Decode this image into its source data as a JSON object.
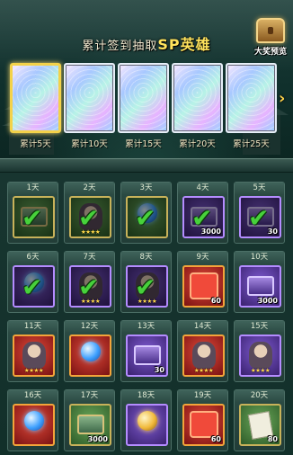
{
  "header": {
    "title_prefix": "累计签到抽取",
    "title_sp": "SP",
    "title_suffix": "英雄",
    "preview_label": "大奖预览"
  },
  "milestones": [
    {
      "label": "累计5天",
      "selected": true
    },
    {
      "label": "累计10天",
      "selected": false
    },
    {
      "label": "累计15天",
      "selected": false
    },
    {
      "label": "累计20天",
      "selected": false
    },
    {
      "label": "累计25天",
      "selected": false
    }
  ],
  "days": [
    {
      "day": "1天",
      "kind": "green",
      "icon": "chest-icon",
      "claimed": true,
      "qty": "",
      "stars": ""
    },
    {
      "day": "2天",
      "kind": "green",
      "icon": "hero-icon",
      "claimed": true,
      "qty": "",
      "stars": "★★★★"
    },
    {
      "day": "3天",
      "kind": "green",
      "icon": "orb-icon",
      "claimed": true,
      "qty": "",
      "stars": ""
    },
    {
      "day": "4天",
      "kind": "purple",
      "icon": "chest-icon",
      "claimed": true,
      "qty": "3000",
      "stars": ""
    },
    {
      "day": "5天",
      "kind": "purple",
      "icon": "chest-icon",
      "claimed": true,
      "qty": "30",
      "stars": ""
    },
    {
      "day": "6天",
      "kind": "purple",
      "icon": "orb-icon",
      "claimed": true,
      "qty": "",
      "stars": ""
    },
    {
      "day": "7天",
      "kind": "purple",
      "icon": "hero-icon",
      "claimed": true,
      "qty": "",
      "stars": "★★★★"
    },
    {
      "day": "8天",
      "kind": "purple",
      "icon": "hero-icon",
      "claimed": true,
      "qty": "",
      "stars": "★★★★"
    },
    {
      "day": "9天",
      "kind": "red",
      "icon": "puzzle-piece-icon",
      "claimed": false,
      "qty": "60",
      "stars": ""
    },
    {
      "day": "10天",
      "kind": "purple",
      "icon": "chest-icon",
      "claimed": false,
      "qty": "3000",
      "stars": ""
    },
    {
      "day": "11天",
      "kind": "red",
      "icon": "hero-icon",
      "claimed": false,
      "qty": "",
      "stars": "★★★★"
    },
    {
      "day": "12天",
      "kind": "red",
      "icon": "orb-icon",
      "claimed": false,
      "qty": "",
      "stars": ""
    },
    {
      "day": "13天",
      "kind": "purple",
      "icon": "chest-icon",
      "claimed": false,
      "qty": "30",
      "stars": ""
    },
    {
      "day": "14天",
      "kind": "red",
      "icon": "hero-icon",
      "claimed": false,
      "qty": "",
      "stars": "★★★★"
    },
    {
      "day": "15天",
      "kind": "purple",
      "icon": "hero-icon",
      "claimed": false,
      "qty": "",
      "stars": "★★★★"
    },
    {
      "day": "16天",
      "kind": "red",
      "icon": "orb-icon",
      "claimed": false,
      "qty": "",
      "stars": ""
    },
    {
      "day": "17天",
      "kind": "green",
      "icon": "chest-icon",
      "claimed": false,
      "qty": "3000",
      "stars": ""
    },
    {
      "day": "18天",
      "kind": "purple",
      "icon": "orb-gold-icon",
      "claimed": false,
      "qty": "",
      "stars": ""
    },
    {
      "day": "19天",
      "kind": "red",
      "icon": "puzzle-piece-icon",
      "claimed": false,
      "qty": "60",
      "stars": ""
    },
    {
      "day": "20天",
      "kind": "green",
      "icon": "scroll-icon",
      "claimed": false,
      "qty": "80",
      "stars": ""
    }
  ]
}
